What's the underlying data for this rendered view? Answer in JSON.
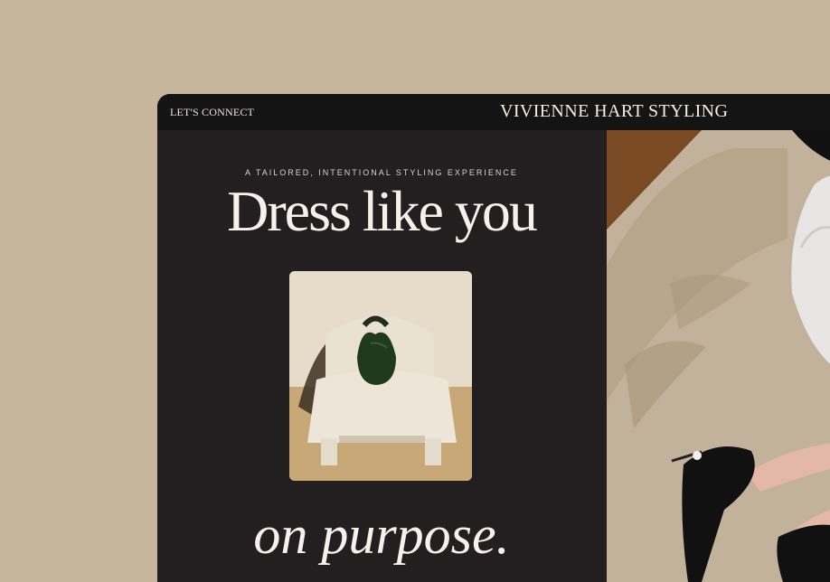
{
  "header": {
    "nav_link": "LET'S CONNECT",
    "brand": "VIVIENNE HART STYLING"
  },
  "hero": {
    "kicker": "A TAILORED, INTENTIONAL STYLING EXPERIENCE",
    "headline": "Dress like you",
    "tagline": "on purpose."
  },
  "images": {
    "card": "chair-with-handbag-photo",
    "side": "woman-on-sofa-heels-photo"
  },
  "colors": {
    "page_bg": "#c6b69c",
    "panel_bg": "#231f20",
    "topbar_bg": "#151414",
    "text_light": "#f6f1ea"
  }
}
